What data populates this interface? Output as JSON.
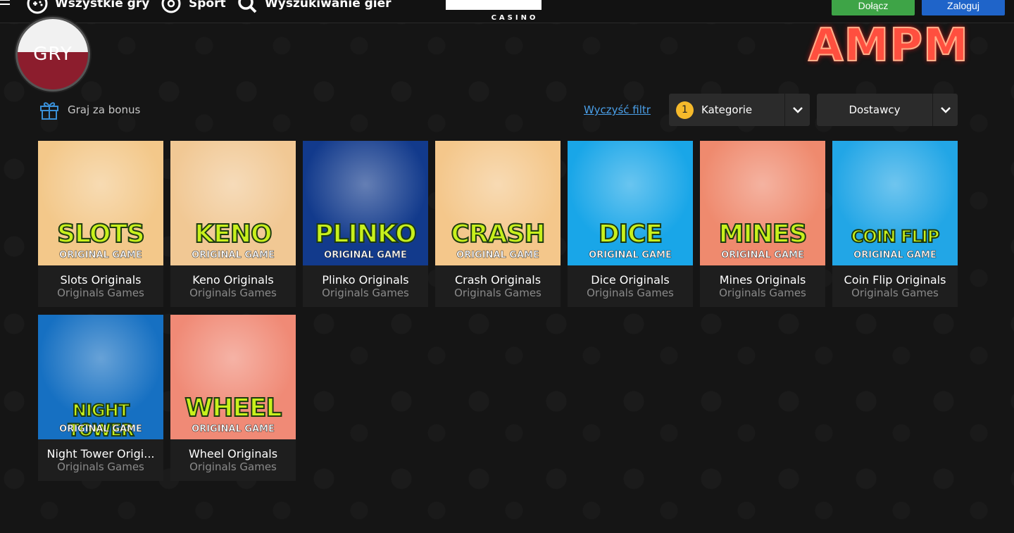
{
  "nav": {
    "all_games": "Wszystkie gry",
    "sport": "Sport",
    "search": "Wyszukiwanie gier"
  },
  "logo": {
    "sub": "CASINO"
  },
  "buttons": {
    "join": "Dołącz",
    "login": "Zaloguj"
  },
  "badge": "GRY",
  "ampm": "AMPM",
  "bonus": "Graj za bonus",
  "filters": {
    "clear": "Wyczyść filtr",
    "categories_count": "1",
    "categories": "Kategorie",
    "providers": "Dostawcy"
  },
  "games": [
    {
      "word": "SLOTS",
      "og": "ORIGINAL GAME",
      "title": "Slots Originals",
      "subtitle": "Originals Games",
      "bg": "#f3c88a"
    },
    {
      "word": "KENO",
      "og": "ORIGINAL GAME",
      "title": "Keno Originals",
      "subtitle": "Originals Games",
      "bg": "#f1c894"
    },
    {
      "word": "PLINKO",
      "og": "ORIGINAL GAME",
      "title": "Plinko Originals",
      "subtitle": "Originals Games",
      "bg": "#123a8c"
    },
    {
      "word": "CRASH",
      "og": "ORIGINAL GAME",
      "title": "Crash Originals",
      "subtitle": "Originals Games",
      "bg": "#f4c78b"
    },
    {
      "word": "DICE",
      "og": "ORIGINAL GAME",
      "title": "Dice Originals",
      "subtitle": "Originals Games",
      "bg": "#19a6e8"
    },
    {
      "word": "MINES",
      "og": "ORIGINAL GAME",
      "title": "Mines Originals",
      "subtitle": "Originals Games",
      "bg": "#ef8a6e"
    },
    {
      "word": "COIN FLIP",
      "og": "ORIGINAL GAME",
      "title": "Coin Flip Originals",
      "subtitle": "Originals Games",
      "bg": "#22a6e6"
    },
    {
      "word": "NIGHT TOWER",
      "og": "ORIGINAL GAME",
      "title": "Night Tower Origi...",
      "subtitle": "Originals Games",
      "bg": "#1670c2"
    },
    {
      "word": "WHEEL",
      "og": "ORIGINAL GAME",
      "title": "Wheel Originals",
      "subtitle": "Originals Games",
      "bg": "#f08a76"
    }
  ]
}
